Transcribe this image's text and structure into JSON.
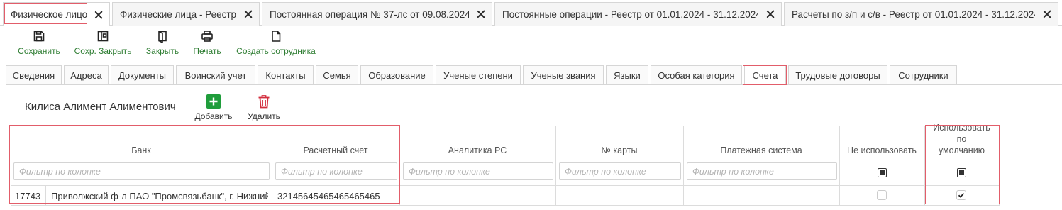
{
  "doc_tabs": [
    {
      "label": "Физическое лицо",
      "active": true
    },
    {
      "label": "Физические лица - Реестр",
      "active": false
    },
    {
      "label": "Постоянная операция № 37-лс от 09.08.2024",
      "active": false
    },
    {
      "label": "Постоянные операции - Реестр от 01.01.2024 - 31.12.2024",
      "active": false
    },
    {
      "label": "Расчеты по з/п и с/в - Реестр от 01.01.2024 - 31.12.2024",
      "active": false
    }
  ],
  "toolbar": {
    "save_label": "Сохранить",
    "save_close_label": "Сохр. Закрыть",
    "close_label": "Закрыть",
    "print_label": "Печать",
    "create_employee_label": "Создать сотрудника"
  },
  "section_tabs": [
    {
      "label": "Сведения"
    },
    {
      "label": "Адреса"
    },
    {
      "label": "Документы"
    },
    {
      "label": "Воинский учет"
    },
    {
      "label": "Контакты"
    },
    {
      "label": "Семья"
    },
    {
      "label": "Образование"
    },
    {
      "label": "Ученые степени"
    },
    {
      "label": "Ученые звания"
    },
    {
      "label": "Языки"
    },
    {
      "label": "Особая категория"
    },
    {
      "label": "Счета"
    },
    {
      "label": "Трудовые договоры"
    },
    {
      "label": "Сотрудники"
    }
  ],
  "active_section": "Счета",
  "panel": {
    "person_name": "Килиса Алимент Алиментович",
    "add_label": "Добавить",
    "delete_label": "Удалить"
  },
  "grid": {
    "columns": {
      "bank": "Банк",
      "account": "Расчетный счет",
      "analytics": "Аналитика РС",
      "card": "№ карты",
      "payment_system": "Платежная система",
      "not_use": "Не использовать",
      "use_default": "Использовать по умолчанию"
    },
    "filter_placeholder": "Фильтр по колонке",
    "rows": [
      {
        "bank_code": "17743",
        "bank_name": "Приволжский ф-л ПАО \"Промсвязьбанк\", г. Нижний Новгород",
        "account": "32145645465465465465",
        "analytics": "",
        "card": "",
        "payment_system": "",
        "not_use": false,
        "use_default": true
      }
    ]
  },
  "colors": {
    "accent_green": "#2e7d32",
    "add_button": "#1f9d3b",
    "delete_icon": "#d32f3f",
    "highlight_box": "#e25d6a"
  }
}
